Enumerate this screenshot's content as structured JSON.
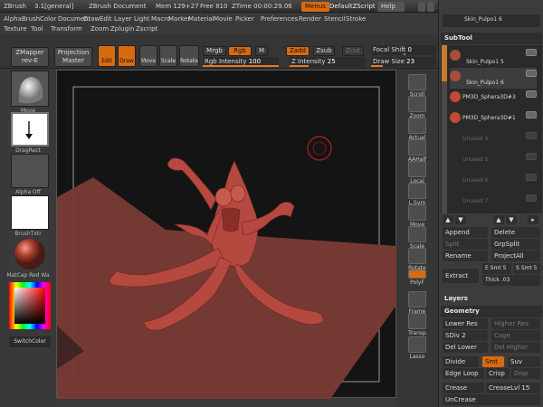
{
  "titlebar": {
    "app": "ZBrush",
    "version": "3.1[general]",
    "document": "ZBrush Document",
    "mem": "Mem 129+27",
    "free": "Free 810",
    "ztime": "ZTime 00:00:29.06",
    "menus_btn": "Menus",
    "script_btn": "DefaultZScript",
    "help_btn": "Help"
  },
  "menubar": {
    "row1": [
      "Alpha",
      "Brush",
      "Color",
      "Document",
      "Draw",
      "Edit",
      "Layer",
      "Light",
      "Macro",
      "Marker",
      "Material",
      "Movie",
      "Picker",
      "Preferences",
      "Render",
      "Stencil",
      "Stroke"
    ],
    "row2": [
      "Texture",
      "Tool",
      "Transform",
      "Zoom",
      "Zplugin",
      "Zscript"
    ]
  },
  "toolbar": {
    "zmapper": "ZMapper",
    "zmapper_rev": "rev-E",
    "projection": "Projection",
    "projection2": "Master",
    "edit": "Edit",
    "draw": "Draw",
    "move": "Move",
    "scale": "Scale",
    "rotate": "Rotate",
    "mrgb": "Mrgb",
    "rgb": "Rgb",
    "m": "M",
    "rgb_intensity_label": "Rgb Intensity",
    "rgb_intensity": "100",
    "zadd": "Zadd",
    "zsub": "Zsub",
    "zcut": "Zcut",
    "z_intensity_label": "Z Intensity",
    "z_intensity": "25",
    "focal_label": "Focal Shift",
    "focal": "0",
    "drawsize_label": "Draw Size",
    "drawsize": "23",
    "rgb_intensity_frac": 1.0,
    "z_intensity_frac": 0.25,
    "drawsize_frac": 0.18
  },
  "leftshelf": {
    "thumb1": "Move",
    "thumb2": "DragRect",
    "thumb3": "Alpha Off",
    "thumb4": "BrushTxtr",
    "thumb5": "MatCap Red Wa",
    "switch": "SwitchColor"
  },
  "rightshelf": [
    "Scroll",
    "Zoom",
    "Actual",
    "AAHalf",
    "Local",
    "L.Sym",
    "Move",
    "Scale",
    "Rotate",
    "PolyF",
    "Frame",
    "Transp",
    "Lasso"
  ],
  "tray": {
    "tool_thumb": "Skin_Pulpo1 6",
    "subtool_head": "SubTool",
    "subtools": [
      {
        "name": "Skin_Pulpo1 5"
      },
      {
        "name": "Skin_Pulpo1 6"
      },
      {
        "name": "PM3D_Sphera3D#3"
      },
      {
        "name": "PM3D_Sphera3D#1"
      },
      {
        "name": "Unused 4"
      },
      {
        "name": "Unused 5"
      },
      {
        "name": "Unused 6"
      },
      {
        "name": "Unused 7"
      }
    ],
    "append": "Append",
    "delete": "Delete",
    "split": "Split",
    "grpsplit": "GrpSplit",
    "rename": "Rename",
    "projectall": "ProjectAll",
    "extract": "Extract",
    "e_smt": "E Smt",
    "e_smt_val": "5",
    "s_smt": "S Smt",
    "s_smt_val": "5",
    "thick": "Thick",
    "thick_val": ".03",
    "layers": "Layers",
    "geometry": "Geometry",
    "lower_res": "Lower Res",
    "higher_res": "Higher Res",
    "sdiv": "SDiv",
    "sdiv_val": "2",
    "cage": "Cage",
    "del_lower": "Del Lower",
    "del_higher": "Del Higher",
    "divide": "Divide",
    "smt": "Smt",
    "suv": "Suv",
    "edge_loop": "Edge Loop",
    "crisp": "Crisp",
    "disp": "Disp",
    "crease": "Crease",
    "creaselvl": "CreaseLvl",
    "creaselvl_val": "15",
    "uncrease": "UnCrease"
  },
  "colors": {
    "accent": "#d86a10",
    "model": "#b5493f",
    "floor": "#7a3b36",
    "canvas": "#141414"
  }
}
